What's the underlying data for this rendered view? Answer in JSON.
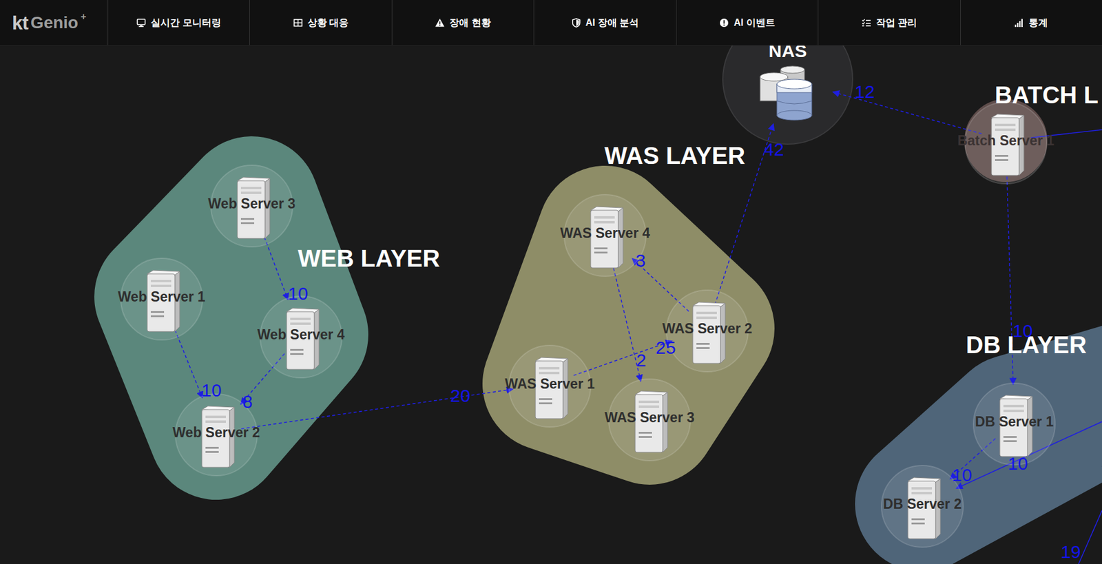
{
  "logo": {
    "mark": "kt",
    "brand": "Genio",
    "sup": "+"
  },
  "nav": [
    {
      "label": "실시간 모니터링"
    },
    {
      "label": "상황 대응"
    },
    {
      "label": "장애 현황"
    },
    {
      "label": "AI 장애 분석"
    },
    {
      "label": "AI 이벤트"
    },
    {
      "label": "작업 관리"
    },
    {
      "label": "통계"
    }
  ],
  "layers": [
    {
      "name": "WEB LAYER",
      "color": "#5b877c"
    },
    {
      "name": "WAS LAYER",
      "color": "#8e8d67"
    },
    {
      "name": "DB LAYER",
      "color": "#4f6579"
    },
    {
      "name": "BATCH L",
      "color": "#5e4c4a"
    },
    {
      "name": "NAS",
      "color": "#2a2a2c"
    }
  ],
  "nodes": [
    {
      "label": "Web Server 3",
      "layer": 0,
      "kind": "server"
    },
    {
      "label": "Web Server 1",
      "layer": 0,
      "kind": "server"
    },
    {
      "label": "Web Server 4",
      "layer": 0,
      "kind": "server"
    },
    {
      "label": "Web Server 2",
      "layer": 0,
      "kind": "server"
    },
    {
      "label": "WAS Server 4",
      "layer": 1,
      "kind": "server"
    },
    {
      "label": "WAS Server 2",
      "layer": 1,
      "kind": "server"
    },
    {
      "label": "WAS Server 1",
      "layer": 1,
      "kind": "server"
    },
    {
      "label": "WAS Server 3",
      "layer": 1,
      "kind": "server"
    },
    {
      "label": "",
      "layer": 4,
      "kind": "storage"
    },
    {
      "label": "Batch Server 1",
      "layer": 3,
      "kind": "server"
    },
    {
      "label": "DB Server 1",
      "layer": 2,
      "kind": "server"
    },
    {
      "label": "DB Server 2",
      "layer": 2,
      "kind": "server"
    }
  ],
  "edges": [
    {
      "from": 0,
      "to": 2,
      "label": "10",
      "kind": "dashed"
    },
    {
      "from": 1,
      "to": 3,
      "label": "10",
      "kind": "dashed"
    },
    {
      "from": 2,
      "to": 3,
      "label": "8",
      "kind": "dashed"
    },
    {
      "from": 3,
      "to": 6,
      "label": "20",
      "kind": "dashed"
    },
    {
      "from": 6,
      "to": 5,
      "label": "25",
      "kind": "dashed"
    },
    {
      "from": 5,
      "to": 4,
      "label": "3",
      "kind": "dashed"
    },
    {
      "from": 4,
      "to": 7,
      "label": "2",
      "kind": "dashed"
    },
    {
      "from": 5,
      "to": 8,
      "label": "42",
      "kind": "dashed"
    },
    {
      "from": 9,
      "to": 8,
      "label": "12",
      "kind": "dashed"
    },
    {
      "from": 9,
      "to": 10,
      "label": "10",
      "kind": "dashed"
    },
    {
      "from": 10,
      "to": 11,
      "label": "10",
      "kind": "dashed"
    },
    {
      "from": -1,
      "to": 11,
      "label": "10",
      "kind": "solid"
    },
    {
      "from": -1,
      "to": -1,
      "label": "19",
      "kind": "solid"
    },
    {
      "from": 9,
      "to": -1,
      "label": "",
      "kind": "solid"
    }
  ]
}
